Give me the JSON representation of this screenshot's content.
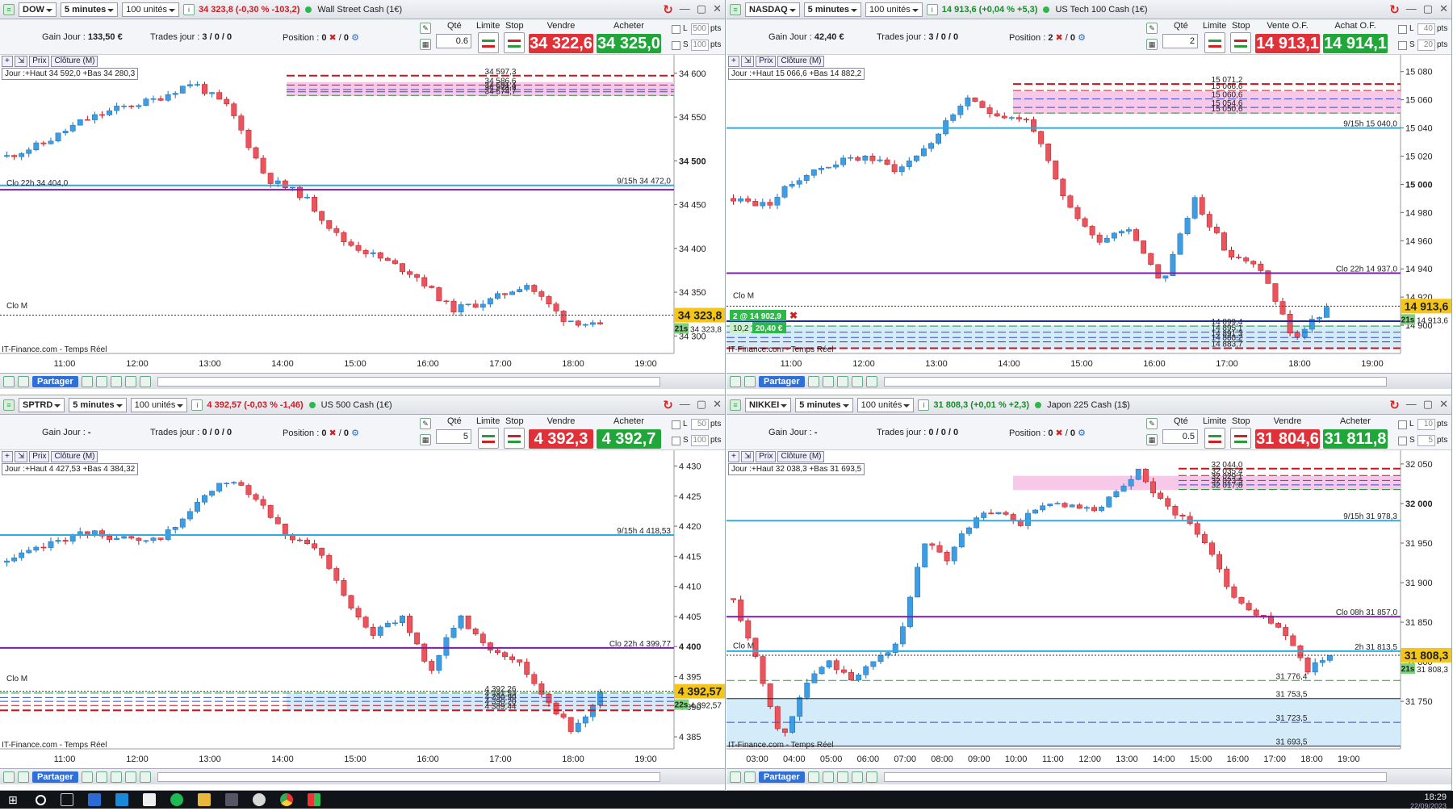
{
  "taskbar": {
    "time": "18:29",
    "date": "22/09/2023"
  },
  "share_label": "Partager",
  "chartbar": {
    "prix": "Prix",
    "cloture": "Clôture (M)"
  },
  "labels": {
    "qte": "Qté",
    "limite": "Limite",
    "stop": "Stop",
    "gain": "Gain Jour :",
    "trades": "Trades jour :",
    "position": "Position :",
    "pts": "pts",
    "L": "L",
    "S": "S"
  },
  "panes": [
    {
      "instrument": "DOW",
      "timeframe": "5 minutes",
      "units": "100 unités",
      "quote": "34 323,8 (-0,30 % -103,2)",
      "quote_positive": false,
      "name": "Wall Street Cash (1€)",
      "gain": "133,50 €",
      "trades": "3 / 0 / 0",
      "position": "0",
      "position2": "0",
      "qty": "0.6",
      "sell_label": "Vendre",
      "buy_label": "Acheter",
      "sell": "34 322,6",
      "buy": "34 325,0",
      "L_pts": "500",
      "S_pts": "100",
      "dayinfo": "Jour :+Haut 34 592,0 +Bas 34 280,3",
      "source": "IT-Finance.com - Temps Réel",
      "ymin": 34280,
      "ymax": 34610,
      "yticks": [
        "34 600",
        "34 550",
        "34 500",
        "34 450",
        "34 400",
        "34 350",
        "34 300"
      ],
      "ytick_vals": [
        34600,
        34550,
        34500,
        34450,
        34400,
        34350,
        34300
      ],
      "bold_tick": "34 500",
      "xticks": [
        "11:00",
        "12:00",
        "13:00",
        "14:00",
        "15:00",
        "16:00",
        "17:00",
        "18:00",
        "19:00"
      ],
      "current_price": "34 323,8",
      "current_val": 34323.8,
      "timer": "21s",
      "timer_price": "34 323,8",
      "seed": 11,
      "start": 34505,
      "path": [
        34505,
        34520,
        34545,
        34560,
        34570,
        34590,
        34560,
        34480,
        34460,
        34410,
        34390,
        34370,
        34330,
        34340,
        34360,
        34320,
        34310
      ],
      "lines": [
        {
          "v": 34597.3,
          "color": "#c8141e",
          "style": "dash",
          "w": 2,
          "label": "34 597,3"
        },
        {
          "v": 34586.6,
          "color": "#c8141e",
          "style": "dash",
          "w": 1,
          "label": "34 586,6"
        },
        {
          "v": 34581.4,
          "color": "#3a4cc8",
          "style": "dash",
          "w": 1,
          "label": "34 581,4"
        },
        {
          "v": 34578.9,
          "color": "#3a4cc8",
          "style": "dash",
          "w": 1,
          "label": "34 578,9"
        },
        {
          "v": 34574.7,
          "color": "#2a9a3a",
          "style": "dash",
          "w": 1,
          "label": "34 574,7"
        },
        {
          "v": 34472.0,
          "color": "#33aadd",
          "style": "solid",
          "w": 2,
          "label": "9/15h 34 472,0",
          "right": true
        },
        {
          "v": 34467,
          "color": "#7a1fa8",
          "style": "solid",
          "w": 2,
          "label": ""
        },
        {
          "v": 34323.8,
          "color": "#333",
          "style": "dot",
          "w": 1,
          "label": ""
        }
      ],
      "left_labels": [
        {
          "v": 34470,
          "text": "Clo 22h 34 404,0"
        },
        {
          "v": 34330,
          "text": "Clo M"
        }
      ],
      "zone": {
        "from": 34574,
        "to": 34590,
        "color": "#f8c8e8"
      }
    },
    {
      "instrument": "NASDAQ",
      "timeframe": "5 minutes",
      "units": "100 unités",
      "quote": "14 913,6 (+0,04 % +5,3)",
      "quote_positive": true,
      "name": "US Tech 100 Cash (1€)",
      "gain": "42,40 €",
      "trades": "3 / 0 / 0",
      "position": "2",
      "position2": "0",
      "qty": "2",
      "sell_label": "Vente O.F.",
      "buy_label": "Achat O.F.",
      "sell": "14 913,1",
      "buy": "14 914,1",
      "L_pts": "40",
      "S_pts": "20",
      "dayinfo": "Jour :+Haut 15 066,6 +Bas 14 882,2",
      "source": "IT-Finance.com - Temps Réel",
      "ymin": 14880,
      "ymax": 15085,
      "yticks": [
        "15 080",
        "15 060",
        "15 040",
        "15 020",
        "15 000",
        "14 980",
        "14 960",
        "14 940",
        "14 920",
        "14 900"
      ],
      "ytick_vals": [
        15080,
        15060,
        15040,
        15020,
        15000,
        14980,
        14960,
        14940,
        14920,
        14900
      ],
      "bold_tick": "15 000",
      "xticks": [
        "11:00",
        "12:00",
        "13:00",
        "14:00",
        "15:00",
        "16:00",
        "17:00",
        "18:00",
        "19:00"
      ],
      "current_price": "14 913,6",
      "current_val": 14913.6,
      "timer": "21s",
      "timer_price": "14 913,6",
      "position_box": "2 @ 14 902,9",
      "pnl_box": "10,2",
      "pnl_eur": "20,40 €",
      "seed": 23,
      "start": 14990,
      "path": [
        14990,
        14985,
        15005,
        15015,
        15020,
        15010,
        15030,
        15060,
        15050,
        15045,
        14990,
        14960,
        14970,
        14930,
        14990,
        14950,
        14940,
        14890,
        14912
      ],
      "lines": [
        {
          "v": 15071.2,
          "color": "#c8141e",
          "style": "dash",
          "w": 2,
          "label": "15 071,2"
        },
        {
          "v": 15066.6,
          "color": "#c8141e",
          "style": "dash",
          "w": 1,
          "label": "15 066,6"
        },
        {
          "v": 15060.6,
          "color": "#3a4cc8",
          "style": "dash",
          "w": 1,
          "label": "15 060,6"
        },
        {
          "v": 15054.6,
          "color": "#3a4cc8",
          "style": "dash",
          "w": 1,
          "label": "15 054,6"
        },
        {
          "v": 15050.6,
          "color": "#2a9a3a",
          "style": "dash",
          "w": 1,
          "label": "15 050,6"
        },
        {
          "v": 15040.0,
          "color": "#33aadd",
          "style": "solid",
          "w": 2,
          "label": "9/15h 15 040,0",
          "right": true
        },
        {
          "v": 14937.0,
          "color": "#7a1fa8",
          "style": "solid",
          "w": 2,
          "label": "Clo 22h 14 937,0",
          "right": true
        },
        {
          "v": 14913.6,
          "color": "#333",
          "style": "dot",
          "w": 1,
          "label": ""
        },
        {
          "v": 14902.9,
          "color": "#1a2aa8",
          "style": "solid",
          "w": 2,
          "label": ""
        },
        {
          "v": 14899.4,
          "color": "#2a9a3a",
          "style": "dash",
          "w": 1,
          "label": "14 899,4"
        },
        {
          "v": 14895.1,
          "color": "#3a4cc8",
          "style": "dash",
          "w": 1,
          "label": "14 895,1"
        },
        {
          "v": 14891.3,
          "color": "#3a4cc8",
          "style": "dash",
          "w": 1,
          "label": "14 891,3"
        },
        {
          "v": 14888.2,
          "color": "#c8141e",
          "style": "dash",
          "w": 1,
          "label": "14 888,2"
        },
        {
          "v": 14883.7,
          "color": "#c8141e",
          "style": "dash",
          "w": 2,
          "label": "14 883,7"
        }
      ],
      "left_labels": [
        {
          "v": 14918,
          "text": "Clo M"
        }
      ],
      "zone": {
        "from": 15050,
        "to": 15066,
        "color": "#f8c8e8"
      },
      "zone2": {
        "from": 14883,
        "to": 14900,
        "color": "#d4ecfa"
      }
    },
    {
      "instrument": "SPTRD",
      "timeframe": "5 minutes",
      "units": "100 unités",
      "quote": "4 392,57 (-0,03 % -1,46)",
      "quote_positive": false,
      "name": "US 500 Cash (1€)",
      "gain": "-",
      "trades": "0 / 0 / 0",
      "position": "0",
      "position2": "0",
      "qty": "5",
      "sell_label": "Vendre",
      "buy_label": "Acheter",
      "sell": "4 392,3",
      "buy": "4 392,7",
      "L_pts": "50",
      "S_pts": "100",
      "dayinfo": "Jour :+Haut 4 427,53 +Bas 4 384,32",
      "source": "IT-Finance.com - Temps Réel",
      "ymin": 4383,
      "ymax": 4431,
      "yticks": [
        "4 430",
        "4 425",
        "4 420",
        "4 415",
        "4 410",
        "4 405",
        "4 400",
        "4 395",
        "4 390",
        "4 385"
      ],
      "ytick_vals": [
        4430,
        4425,
        4420,
        4415,
        4410,
        4405,
        4400,
        4395,
        4390,
        4385
      ],
      "bold_tick": "4 400",
      "xticks": [
        "11:00",
        "12:00",
        "13:00",
        "14:00",
        "15:00",
        "16:00",
        "17:00",
        "18:00",
        "19:00"
      ],
      "current_price": "4 392,57",
      "current_val": 4392.57,
      "timer": "22s",
      "timer_price": "4 392,57",
      "seed": 37,
      "start": 4414,
      "path": [
        4414,
        4416,
        4418,
        4419,
        4418,
        4417,
        4420,
        4425,
        4428,
        4424,
        4418,
        4416,
        4408,
        4402,
        4405,
        4396,
        4405,
        4400,
        4398,
        4392,
        4386,
        4392
      ],
      "lines": [
        {
          "v": 4418.53,
          "color": "#33aadd",
          "style": "solid",
          "w": 2,
          "label": "9/15h 4 418,53",
          "right": true
        },
        {
          "v": 4399.77,
          "color": "#7a1fa8",
          "style": "solid",
          "w": 2,
          "label": "Clo 22h 4 399,77",
          "right": true
        },
        {
          "v": 4392.57,
          "color": "#333",
          "style": "dot",
          "w": 1,
          "label": ""
        },
        {
          "v": 4392.26,
          "color": "#2a9a3a",
          "style": "dash",
          "w": 1,
          "label": "4 392,26"
        },
        {
          "v": 4391.53,
          "color": "#3a4cc8",
          "style": "dash",
          "w": 1,
          "label": "4 391,53"
        },
        {
          "v": 4390.9,
          "color": "#3a4cc8",
          "style": "dash",
          "w": 1,
          "label": "4 390,90"
        },
        {
          "v": 4390.2,
          "color": "#c8141e",
          "style": "dash",
          "w": 1,
          "label": "4 390,20"
        },
        {
          "v": 4389.4,
          "color": "#c8141e",
          "style": "dash",
          "w": 2,
          "label": "4 389,44"
        }
      ],
      "left_labels": [
        {
          "v": 4394,
          "text": "Clo M"
        }
      ],
      "zone2": {
        "from": 4389.4,
        "to": 4392.2,
        "color": "#d4ecfa"
      }
    },
    {
      "instrument": "NIKKEI",
      "timeframe": "5 minutes",
      "units": "100 unités",
      "quote": "31 808,3 (+0,01 % +2,3)",
      "quote_positive": true,
      "name": "Japon 225 Cash (1$)",
      "gain": "-",
      "trades": "0 / 0 / 0",
      "position": "0",
      "position2": "0",
      "qty": "0.5",
      "sell_label": "Vendre",
      "buy_label": "Acheter",
      "sell": "31 804,6",
      "buy": "31 811,8",
      "L_pts": "10",
      "S_pts": "5",
      "dayinfo": "Jour :+Haut 32 038,3 +Bas 31 693,5",
      "source": "IT-Finance.com - Temps Réel",
      "ymin": 31690,
      "ymax": 32055,
      "yticks": [
        "32 050",
        "32 000",
        "31 950",
        "31 900",
        "31 850",
        "31 800",
        "31 750"
      ],
      "ytick_vals": [
        32050,
        32000,
        31950,
        31900,
        31850,
        31800,
        31750
      ],
      "bold_tick": "32 000",
      "xticks": [
        "03:00",
        "04:00",
        "05:00",
        "06:00",
        "07:00",
        "08:00",
        "09:00",
        "10:00",
        "11:00",
        "12:00",
        "13:00",
        "14:00",
        "15:00",
        "16:00",
        "17:00",
        "18:00",
        "19:00"
      ],
      "current_price": "31 808,3",
      "current_val": 31808.3,
      "timer": "21s",
      "timer_price": "31 808,3",
      "seed": 53,
      "start": 31880,
      "path": [
        31880,
        31800,
        31700,
        31770,
        31800,
        31780,
        31800,
        31830,
        31950,
        31930,
        31980,
        31990,
        31975,
        32000,
        31995,
        31990,
        32010,
        32040,
        32000,
        31980,
        31940,
        31880,
        31860,
        31840,
        31790,
        31808
      ],
      "lines": [
        {
          "v": 32044.0,
          "color": "#c8141e",
          "style": "dash",
          "w": 2,
          "label": "32 044,0"
        },
        {
          "v": 32035.4,
          "color": "#c8141e",
          "style": "dash",
          "w": 1,
          "label": "32 035,4"
        },
        {
          "v": 32029.1,
          "color": "#3a4cc8",
          "style": "dash",
          "w": 1,
          "label": "32 029,1"
        },
        {
          "v": 32023.5,
          "color": "#3a4cc8",
          "style": "dash",
          "w": 1,
          "label": "32 023,5"
        },
        {
          "v": 32017.8,
          "color": "#2a9a3a",
          "style": "dash",
          "w": 1,
          "label": "32 017,8"
        },
        {
          "v": 31978.3,
          "color": "#33aadd",
          "style": "solid",
          "w": 2,
          "label": "9/15h 31 978,3",
          "right": true
        },
        {
          "v": 31857.0,
          "color": "#7a1fa8",
          "style": "solid",
          "w": 2,
          "label": "Clo 08h 31 857,0",
          "right": true
        },
        {
          "v": 31813.5,
          "color": "#33aadd",
          "style": "solid",
          "w": 2,
          "label": "2h 31 813,5",
          "right": true
        },
        {
          "v": 31808.3,
          "color": "#333",
          "style": "dot",
          "w": 1,
          "label": ""
        },
        {
          "v": 31776.4,
          "color": "#2a9a3a",
          "style": "dash",
          "w": 1,
          "label": "31 776,4"
        },
        {
          "v": 31723.5,
          "color": "#3a4cc8",
          "style": "dash",
          "w": 1,
          "label": "31 723,5"
        }
      ],
      "plain_labels": [
        {
          "v": 31753.5,
          "text": "31 753,5"
        },
        {
          "v": 31693.5,
          "text": "31 693,5"
        }
      ],
      "left_labels": [
        {
          "v": 31815,
          "text": "Clo M"
        }
      ],
      "zone": {
        "from": 32017,
        "to": 32035,
        "color": "#f8c8e8"
      },
      "zone2": {
        "from": 31693.5,
        "to": 31753.5,
        "color": "#d4ecfa"
      }
    }
  ]
}
